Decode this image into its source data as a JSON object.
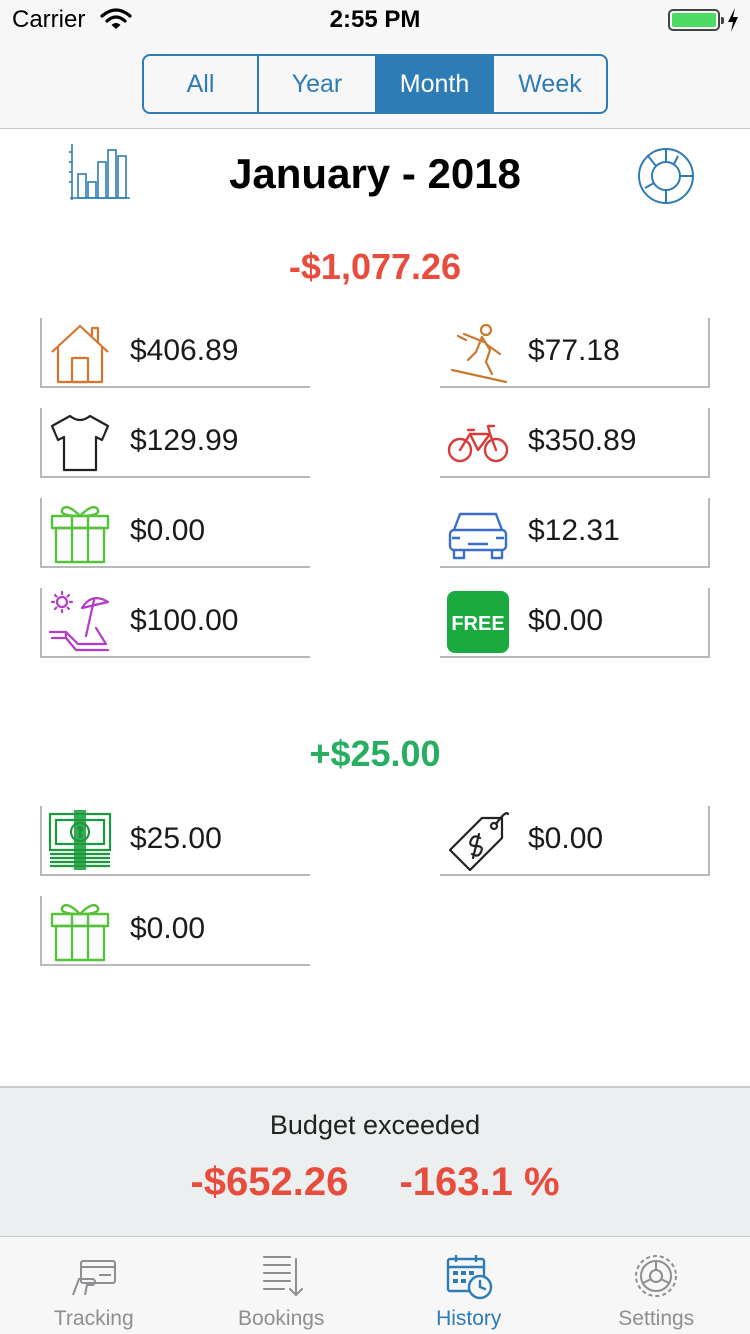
{
  "status": {
    "carrier": "Carrier",
    "time": "2:55 PM"
  },
  "segments": [
    {
      "label": "All",
      "active": false
    },
    {
      "label": "Year",
      "active": false
    },
    {
      "label": "Month",
      "active": true
    },
    {
      "label": "Week",
      "active": false
    }
  ],
  "header": {
    "title": "January - 2018"
  },
  "expenses": {
    "total": "-$1,077.26",
    "items": [
      {
        "icon": "house-icon",
        "amount": "$406.89"
      },
      {
        "icon": "skier-icon",
        "amount": "$77.18"
      },
      {
        "icon": "tshirt-icon",
        "amount": "$129.99"
      },
      {
        "icon": "bicycle-icon",
        "amount": "$350.89"
      },
      {
        "icon": "gift-icon",
        "amount": "$0.00"
      },
      {
        "icon": "car-icon",
        "amount": "$12.31"
      },
      {
        "icon": "beach-chair-icon",
        "amount": "$100.00"
      },
      {
        "icon": "free-badge-icon",
        "amount": "$0.00"
      }
    ]
  },
  "free_badge_text": "FREE",
  "income": {
    "total": "+$25.00",
    "items": [
      {
        "icon": "cash-icon",
        "amount": "$25.00"
      },
      {
        "icon": "price-tag-icon",
        "amount": "$0.00"
      },
      {
        "icon": "gift-icon",
        "amount": "$0.00"
      }
    ]
  },
  "budget": {
    "label": "Budget exceeded",
    "amount": "-$652.26",
    "percent": "-163.1 %"
  },
  "tabs": [
    {
      "label": "Tracking",
      "icon": "card-icon",
      "active": false
    },
    {
      "label": "Bookings",
      "icon": "list-icon",
      "active": false
    },
    {
      "label": "History",
      "icon": "calendar-clock-icon",
      "active": true
    },
    {
      "label": "Settings",
      "icon": "gear-icon",
      "active": false
    }
  ],
  "colors": {
    "accent": "#2e7cb6",
    "negative": "#e74c3c",
    "positive": "#27ae60",
    "house": "#d7752f",
    "skier": "#c9782f",
    "bicycle": "#d93a3a",
    "gift": "#56c13a",
    "car": "#3a6fc9",
    "beach": "#b43cc6",
    "free": "#1aaa3f",
    "cash": "#1a9a3a"
  }
}
